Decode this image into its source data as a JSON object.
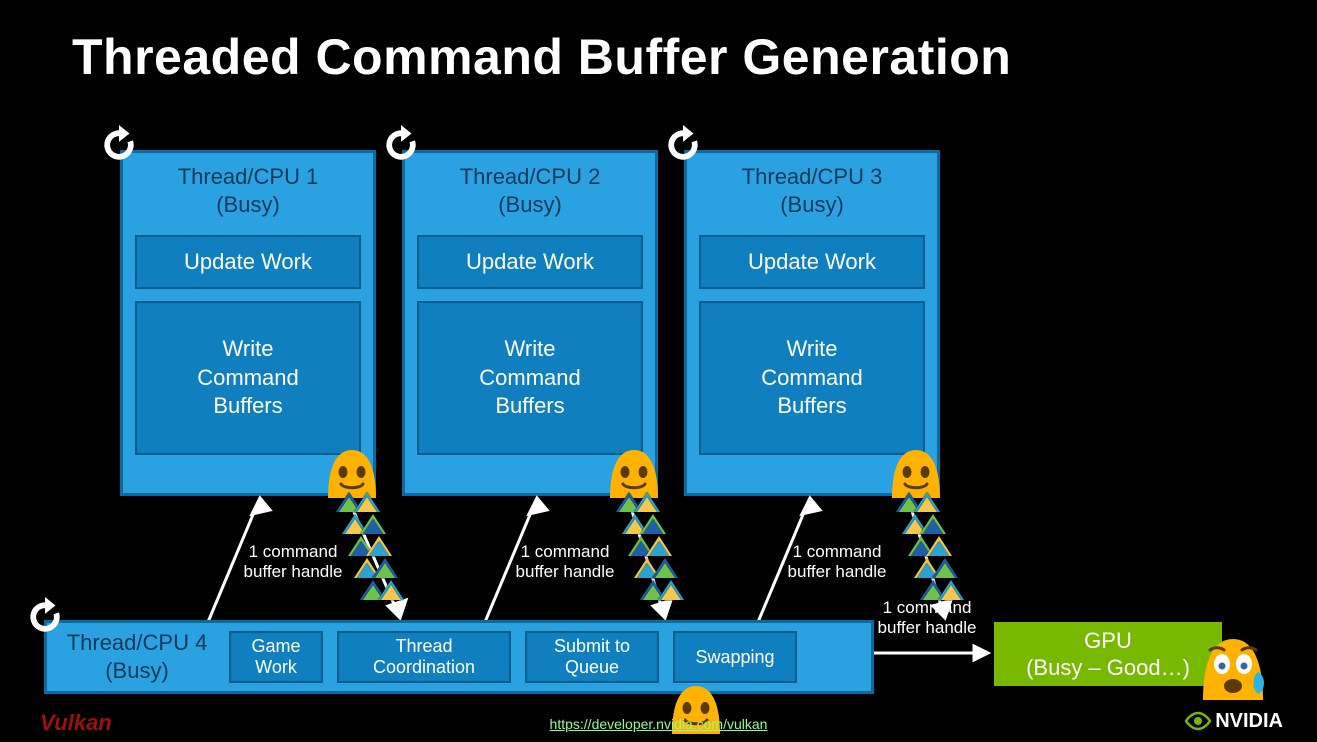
{
  "title": "Threaded Command Buffer Generation",
  "threads": [
    {
      "label_line1": "Thread/CPU 1",
      "label_line2": "(Busy)",
      "update": "Update Work",
      "write": "Write\nCommand\nBuffers"
    },
    {
      "label_line1": "Thread/CPU 2",
      "label_line2": "(Busy)",
      "update": "Update Work",
      "write": "Write\nCommand\nBuffers"
    },
    {
      "label_line1": "Thread/CPU 3",
      "label_line2": "(Busy)",
      "update": "Update Work",
      "write": "Write\nCommand\nBuffers"
    }
  ],
  "annotations": {
    "cmd_buf_handle_1": "1 command\nbuffer handle",
    "cmd_buf_handle_2": "1 command\nbuffer handle",
    "cmd_buf_handle_3": "1 command\nbuffer handle",
    "cmd_buf_handle_gpu": "1 command\nbuffer handle"
  },
  "bottom_thread": {
    "label_line1": "Thread/CPU 4",
    "label_line2": "(Busy)",
    "steps": [
      "Game\nWork",
      "Thread\nCoordination",
      "Submit to\nQueue",
      "Swapping"
    ]
  },
  "gpu_label": "GPU\n(Busy – Good…)",
  "footer_link": "https://developer.nvidia.com/vulkan",
  "logo_left": "Vulkan",
  "logo_right": "NVIDIA",
  "colors": {
    "bg": "#000000",
    "box": "#2aa1e0",
    "box_border": "#0b6aa0",
    "inner": "#0f7fbf",
    "gpu": "#76b900"
  }
}
